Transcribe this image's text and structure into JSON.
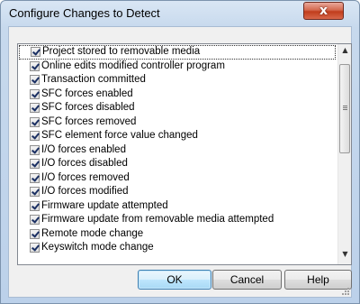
{
  "window": {
    "title": "Configure Changes to Detect",
    "close_glyph": "x"
  },
  "list": {
    "items": [
      {
        "label": "Project stored to removable media",
        "checked": true
      },
      {
        "label": "Online edits modified controller program",
        "checked": true
      },
      {
        "label": "Transaction committed",
        "checked": true
      },
      {
        "label": "SFC forces enabled",
        "checked": true
      },
      {
        "label": "SFC forces disabled",
        "checked": true
      },
      {
        "label": "SFC forces removed",
        "checked": true
      },
      {
        "label": "SFC element force value changed",
        "checked": true
      },
      {
        "label": "I/O forces enabled",
        "checked": true
      },
      {
        "label": "I/O forces disabled",
        "checked": true
      },
      {
        "label": "I/O forces removed",
        "checked": true
      },
      {
        "label": "I/O forces modified",
        "checked": true
      },
      {
        "label": "Firmware update attempted",
        "checked": true
      },
      {
        "label": "Firmware update from removable media attempted",
        "checked": true
      },
      {
        "label": "Remote mode change",
        "checked": true
      },
      {
        "label": "Keyswitch mode change",
        "checked": true
      }
    ],
    "scroll_up_glyph": "▲",
    "scroll_down_glyph": "▼"
  },
  "buttons": {
    "ok": "OK",
    "cancel": "Cancel",
    "help": "Help"
  },
  "colors": {
    "close_button": "#c8452a",
    "default_button_border": "#3c7fb1",
    "checkmark": "#1a2f62"
  }
}
